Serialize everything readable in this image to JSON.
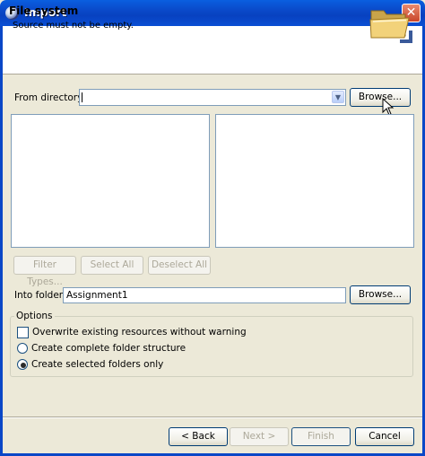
{
  "window": {
    "title": "Import",
    "close_glyph": "✕"
  },
  "header": {
    "title": "File system",
    "message": "Source must not be empty.",
    "icon": "folder-icon"
  },
  "from_directory": {
    "label": "From directory:",
    "value": "",
    "dropdown_glyph": "▼",
    "browse_label": "Browse..."
  },
  "selection_buttons": {
    "filter_types": "Filter Types...",
    "select_all": "Select All",
    "deselect_all": "Deselect All"
  },
  "into_folder": {
    "label": "Into folder:",
    "value": "Assignment1",
    "browse_label": "Browse..."
  },
  "options": {
    "legend": "Options",
    "overwrite": {
      "label": "Overwrite existing resources without warning",
      "checked": false
    },
    "complete_structure": {
      "label": "Create complete folder structure",
      "selected": false
    },
    "selected_only": {
      "label": "Create selected folders only",
      "selected": true
    }
  },
  "footer": {
    "back": "< Back",
    "next": "Next >",
    "finish": "Finish",
    "cancel": "Cancel"
  },
  "colors": {
    "titlebar": "#0a49c9",
    "dialog_bg": "#ece9d8",
    "header_bg": "#ffffff",
    "field_border": "#7f9db9",
    "disabled_text": "#aca899"
  }
}
